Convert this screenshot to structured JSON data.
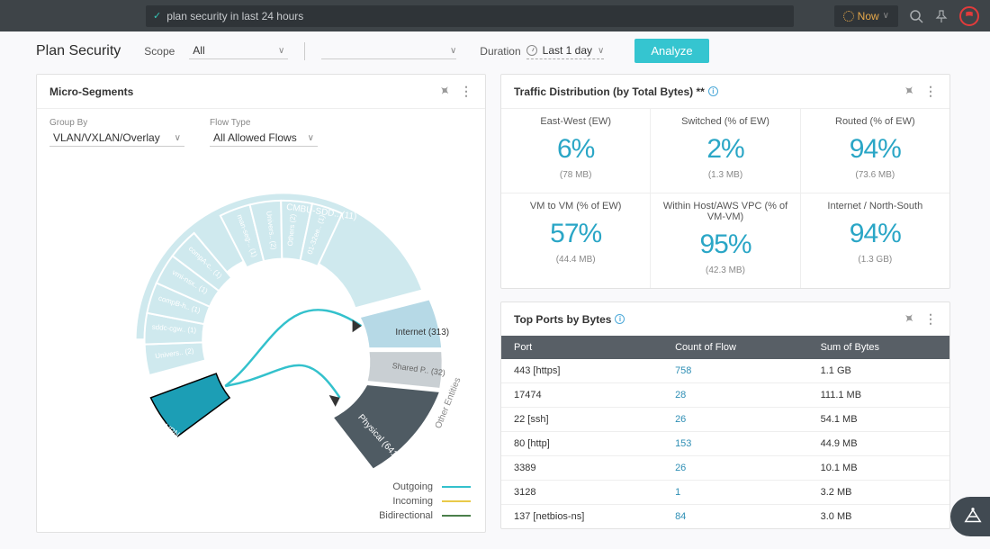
{
  "topbar": {
    "search_text": "plan security in last 24 hours",
    "now_label": "Now"
  },
  "header": {
    "title": "Plan Security",
    "scope_label": "Scope",
    "scope_value": "All",
    "duration_label": "Duration",
    "duration_value": "Last 1 day",
    "analyze_label": "Analyze"
  },
  "micro": {
    "title": "Micro-Segments",
    "group_by_label": "Group By",
    "group_by_value": "VLAN/VXLAN/Overlay",
    "flow_type_label": "Flow Type",
    "flow_type_value": "All Allowed Flows",
    "legend": {
      "outgoing": "Outgoing",
      "incoming": "Incoming",
      "bidirectional": "Bidirectional"
    },
    "colors": {
      "outgoing": "#33c1cc",
      "incoming": "#e9c949",
      "bidirectional": "#4a7f4a"
    },
    "selected_segment": "VMC VPN (1)",
    "other_entities_label": "Other Entities",
    "targets": {
      "internet": "Internet (313)",
      "shared": "Shared P.. (32)",
      "physical": "Physical (641)"
    },
    "segments_small": [
      "Univers.. (2)",
      "sddc-cgw.. (1)",
      "compB-h.. (1)",
      "vrni-nsx.. (1)",
      "compA-c.. (1)",
      "man-seg-.. (2)",
      "man-seg-.. (1)",
      "Univers.. (2)",
      "Others (2)",
      "01-32ee.. (1)"
    ],
    "top_arc": "CMBU-SDD.. (11)"
  },
  "traffic": {
    "title": "Traffic Distribution (by Total Bytes) **",
    "stats": [
      {
        "label": "East-West (EW)",
        "value": "6%",
        "sub": "(78 MB)"
      },
      {
        "label": "Switched (% of EW)",
        "value": "2%",
        "sub": "(1.3 MB)"
      },
      {
        "label": "Routed (% of EW)",
        "value": "94%",
        "sub": "(73.6 MB)"
      },
      {
        "label": "VM to VM (% of EW)",
        "value": "57%",
        "sub": "(44.4 MB)"
      },
      {
        "label": "Within Host/AWS VPC (% of VM-VM)",
        "value": "95%",
        "sub": "(42.3 MB)"
      },
      {
        "label": "Internet / North-South",
        "value": "94%",
        "sub": "(1.3 GB)"
      }
    ]
  },
  "ports": {
    "title": "Top Ports by Bytes",
    "columns": [
      "Port",
      "Count of Flow",
      "Sum of Bytes"
    ],
    "rows": [
      {
        "port": "443 [https]",
        "count": "758",
        "bytes": "1.1 GB"
      },
      {
        "port": "17474",
        "count": "28",
        "bytes": "111.1 MB"
      },
      {
        "port": "22 [ssh]",
        "count": "26",
        "bytes": "54.1 MB"
      },
      {
        "port": "80 [http]",
        "count": "153",
        "bytes": "44.9 MB"
      },
      {
        "port": "3389",
        "count": "26",
        "bytes": "10.1 MB"
      },
      {
        "port": "3128",
        "count": "1",
        "bytes": "3.2 MB"
      },
      {
        "port": "137 [netbios-ns]",
        "count": "84",
        "bytes": "3.0 MB"
      }
    ]
  },
  "chart_data": {
    "type": "other",
    "name": "micro-segments radial flow",
    "selected": "VMC VPN (1)",
    "segments": [
      {
        "name": "CMBU-SDD..",
        "count": 11,
        "highlight": false
      },
      {
        "name": "Univers..",
        "count": 2
      },
      {
        "name": "sddc-cgw..",
        "count": 1
      },
      {
        "name": "compB-h..",
        "count": 1
      },
      {
        "name": "vrni-nsx..",
        "count": 1
      },
      {
        "name": "compA-c..",
        "count": 1
      },
      {
        "name": "VMC VPN",
        "count": 1,
        "highlight": true
      },
      {
        "name": "man-seg-..",
        "count": 2
      },
      {
        "name": "man-seg-..",
        "count": 1
      },
      {
        "name": "Univers..",
        "count": 2
      },
      {
        "name": "Others",
        "count": 2
      },
      {
        "name": "01-32ee..",
        "count": 1
      }
    ],
    "other_entities": [
      {
        "name": "Internet",
        "count": 313
      },
      {
        "name": "Shared P..",
        "count": 32
      },
      {
        "name": "Physical",
        "count": 641
      }
    ],
    "flows_from_selected": [
      {
        "target": "Internet",
        "direction": "outgoing"
      },
      {
        "target": "Physical",
        "direction": "outgoing"
      }
    ]
  }
}
